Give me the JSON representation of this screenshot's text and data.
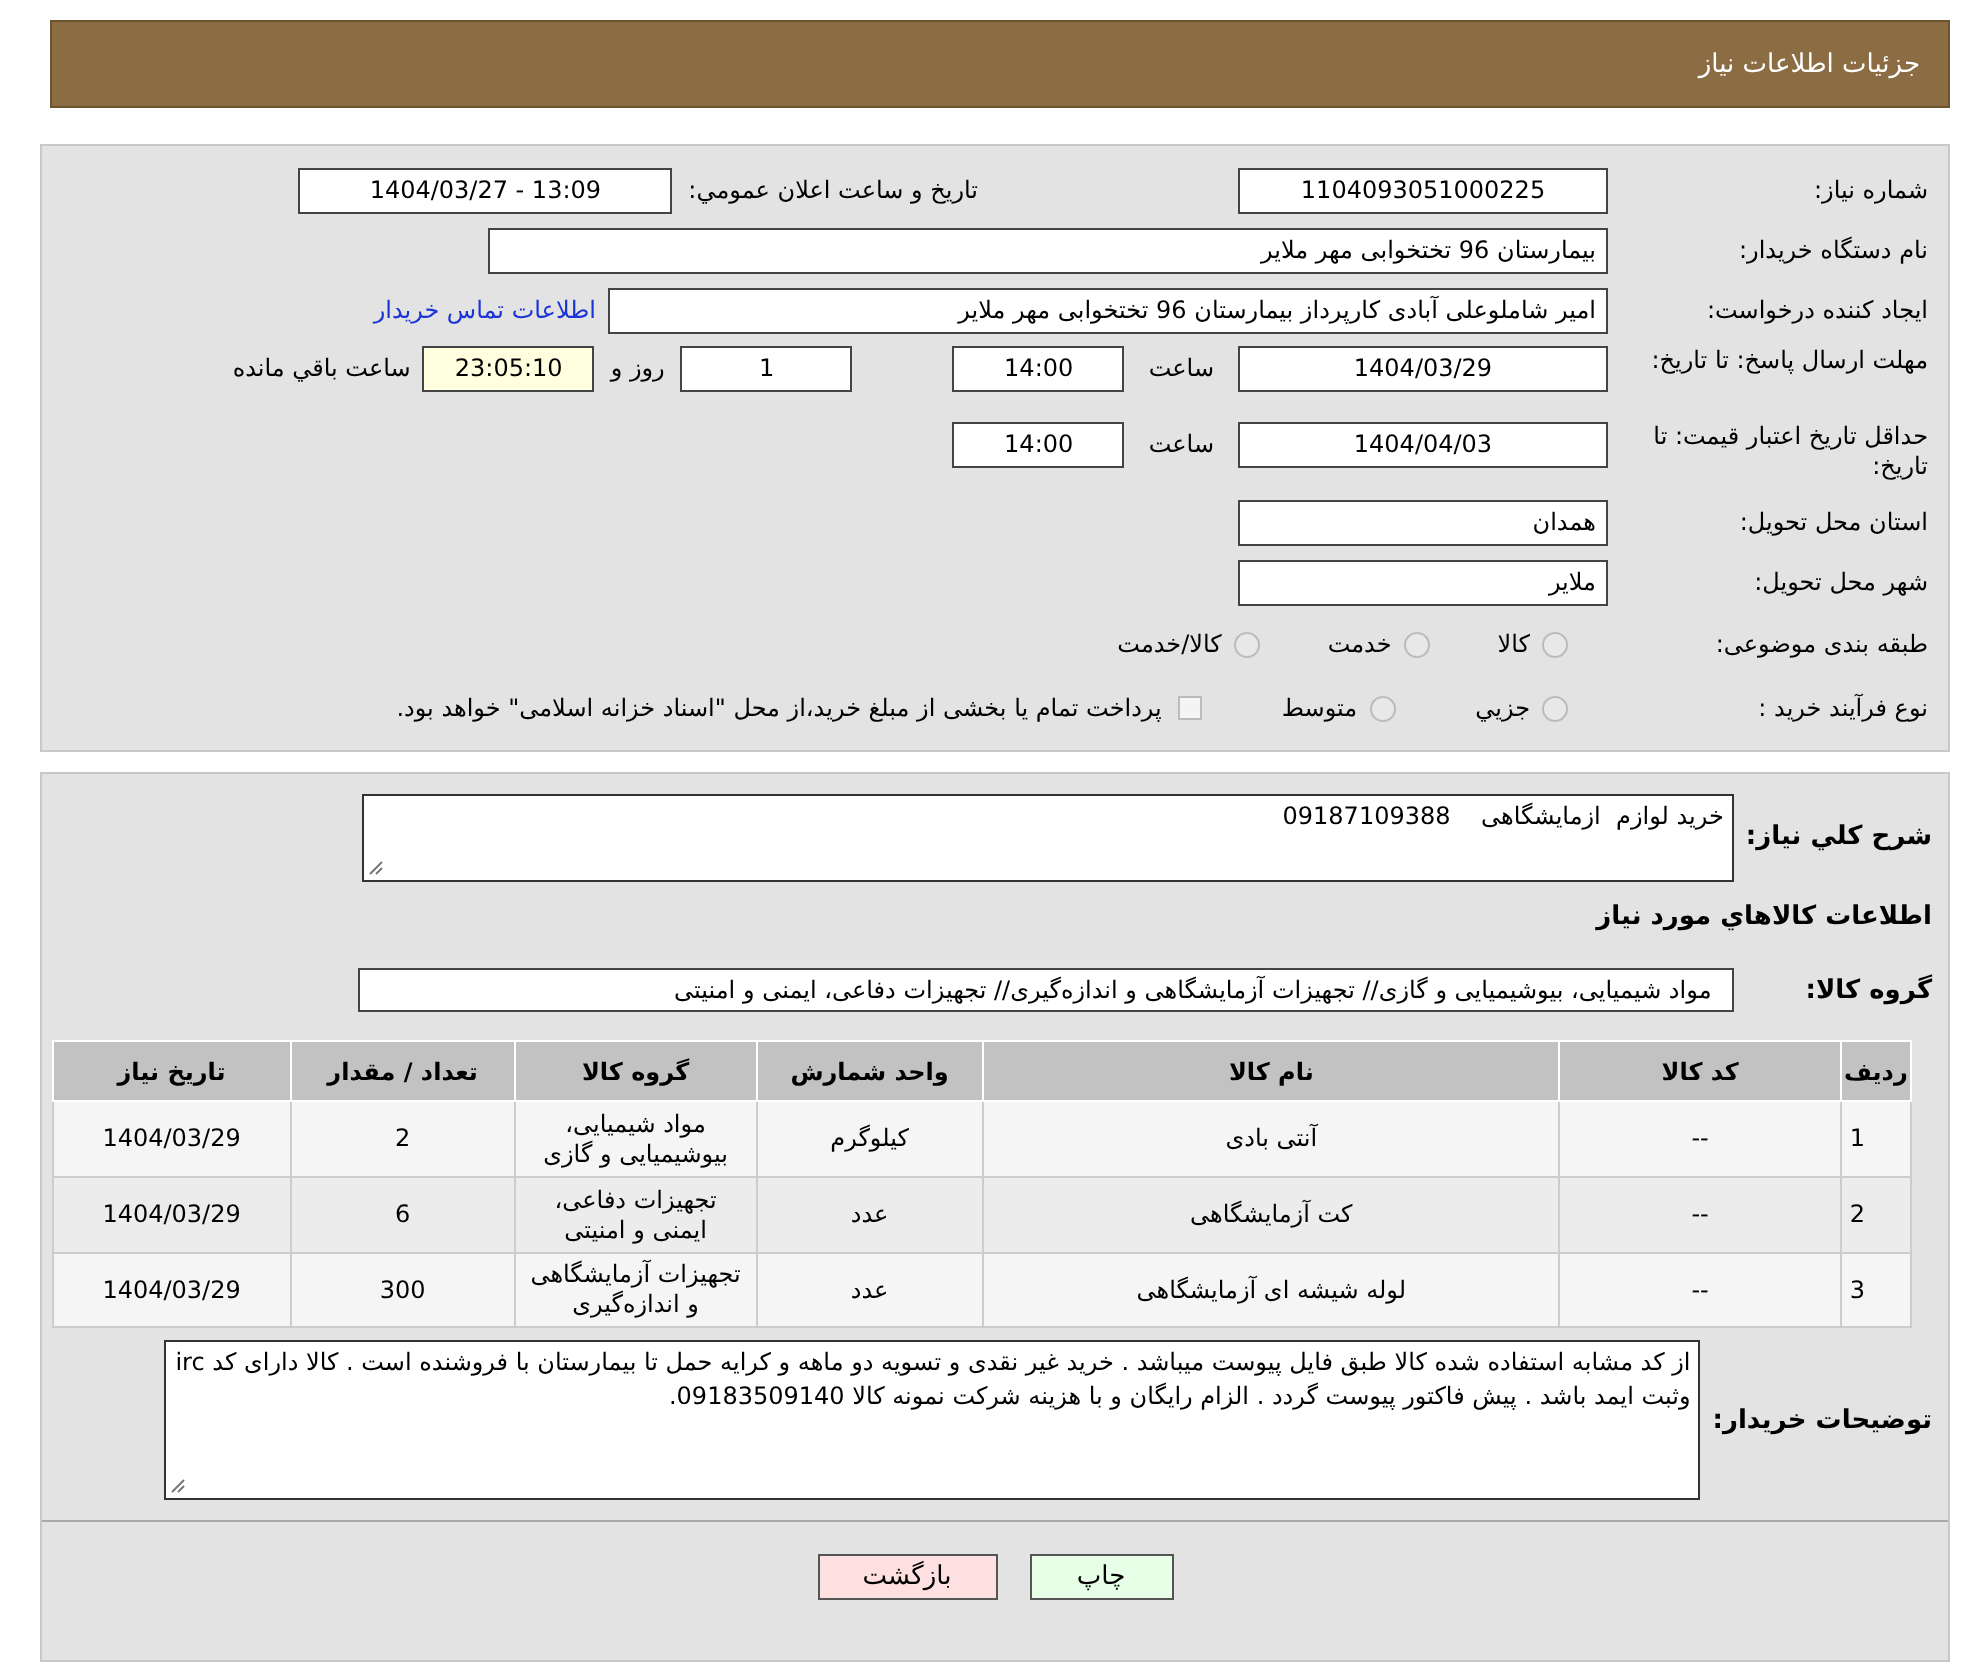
{
  "header": {
    "title": "جزئیات اطلاعات نیاز"
  },
  "form": {
    "need_number": {
      "label": "شماره نیاز:",
      "value": "1104093051000225"
    },
    "announce": {
      "label": "تاریخ و ساعت اعلان عمومي:",
      "value": "1404/03/27 - 13:09"
    },
    "buyer": {
      "label": "نام دستگاه خریدار:",
      "value": "بیمارستان 96 تختخوابی مهر ملایر"
    },
    "creator": {
      "label": "ایجاد کننده درخواست:",
      "value": "امیر شاملوعلی آبادی کارپرداز بیمارستان 96 تختخوابی مهر ملایر",
      "link": "اطلاعات تماس خریدار"
    },
    "reply_deadline": {
      "label": "مهلت ارسال پاسخ: تا تاریخ:",
      "date": "1404/03/29",
      "time_label": "ساعت",
      "time": "14:00",
      "days": "1",
      "days_label": "روز و",
      "remaining": "23:05:10",
      "remaining_label": "ساعت باقي مانده"
    },
    "price_validity": {
      "label": "حداقل تاریخ اعتبار قیمت: تا تاریخ:",
      "date": "1404/04/03",
      "time_label": "ساعت",
      "time": "14:00"
    },
    "province": {
      "label": "استان محل تحویل:",
      "value": "همدان"
    },
    "city": {
      "label": "شهر محل تحویل:",
      "value": "ملایر"
    },
    "category": {
      "label": "طبقه بندی موضوعی:",
      "options": [
        {
          "label": "کالا",
          "selected": false
        },
        {
          "label": "خدمت",
          "selected": false
        },
        {
          "label": "کالا/خدمت",
          "selected": false
        }
      ]
    },
    "process": {
      "label": "نوع فرآیند خرید :",
      "options": [
        {
          "label": "جزيي",
          "selected": false
        },
        {
          "label": "متوسط",
          "selected": false
        }
      ],
      "note": {
        "label": "پرداخت تمام یا بخشی از مبلغ خرید،از محل \"اسناد خزانه اسلامی\" خواهد بود.",
        "checked": false
      }
    }
  },
  "details": {
    "description": {
      "label": "شرح کلي نیاز:",
      "value": "خرید لوازم  ازمایشگاهی    09187109388"
    },
    "items_heading": "اطلاعات کالاهاي مورد نیاز",
    "goods_group": {
      "label": "گروه کالا:",
      "value": "مواد شیمیایی، بیوشیمیایی و  گازی// تجهیزات آزمایشگاهی و اندازه‌گیری// تجهیزات دفاعی، ایمنی و امنیتی"
    },
    "table": {
      "columns": [
        "ردیف",
        "کد کالا",
        "نام کالا",
        "واحد شمارش",
        "گروه کالا",
        "تعداد / مقدار",
        "تاریخ نیاز"
      ],
      "rows": [
        [
          "1",
          "--",
          "آنتی بادی",
          "کیلوگرم",
          "مواد شیمیایی، بیوشیمیایی و گازی",
          "2",
          "1404/03/29"
        ],
        [
          "2",
          "--",
          "کت آزمایشگاهی",
          "عدد",
          "تجهیزات دفاعی، ایمنی و امنیتی",
          "6",
          "1404/03/29"
        ],
        [
          "3",
          "--",
          "لوله شیشه ای آزمایشگاهی",
          "عدد",
          "تجهیزات آزمایشگاهی و اندازه‌گیری",
          "300",
          "1404/03/29"
        ]
      ]
    },
    "buyer_notes": {
      "label": "توضیحات خریدار:",
      "value": "از کد مشابه استفاده شده کالا طبق فایل پیوست  میباشد . خرید غیر نقدی و تسویه دو ماهه  و کرایه حمل تا بیمارستان با فروشنده است . کالا دارای کد irc  وثبت ایمد باشد . پیش فاکتور پیوست گردد . الزام رایگان و با هزینه شرکت نمونه کالا 09183509140."
    }
  },
  "buttons": [
    {
      "kind": "print",
      "label": "چاپ"
    },
    {
      "kind": "back",
      "label": "بازگشت"
    }
  ]
}
